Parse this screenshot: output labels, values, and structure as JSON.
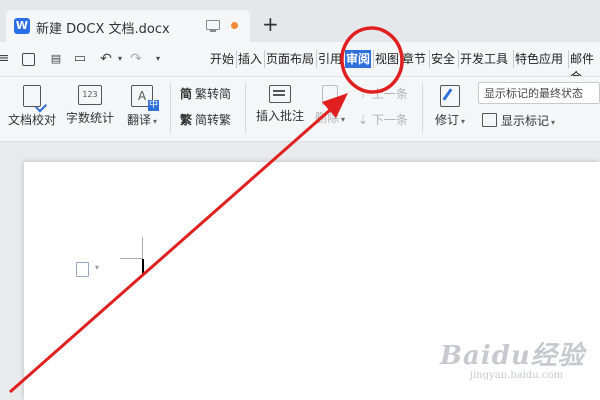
{
  "window": {
    "tab_title": "新建 DOCX 文档.docx",
    "app_icon_letter": "W",
    "new_tab_symbol": "+"
  },
  "quick_access": {
    "undo_symbol": "↶",
    "redo_symbol": "↷",
    "menu_symbol": "≡"
  },
  "menu": {
    "items": [
      "开始",
      "插入",
      "页面布局",
      "引用",
      "审阅",
      "视图",
      "章节",
      "安全",
      "开发工具",
      "特色应用",
      "邮件合"
    ],
    "active": "审阅"
  },
  "ribbon": {
    "doc_check": "文档校对",
    "word_count": "字数统计",
    "word_count_icon_text": "123",
    "translate": "翻译",
    "trad_to_simp": "繁转简",
    "simp_to_trad": "简转繁",
    "trad_glyph": "简",
    "simp_glyph": "繁",
    "insert_comment": "插入批注",
    "delete": "删除",
    "prev": "上一条",
    "next": "下一条",
    "track_changes": "修订",
    "markup_dropdown": "显示标记的最终状态",
    "show_markup": "显示标记"
  },
  "watermark": {
    "main": "Baidu经验",
    "sub": "jingyan.baidu.com"
  },
  "colors": {
    "accent": "#2f6fd9",
    "annotation": "#e02020"
  },
  "icons": [
    "app-icon",
    "monitor-icon",
    "save-icon",
    "print-icon",
    "undo-icon",
    "redo-icon",
    "doc-check-icon",
    "word-count-icon",
    "translate-icon",
    "comment-icon",
    "delete-comment-icon",
    "track-changes-icon",
    "markup-icon",
    "paragraph-icon"
  ]
}
